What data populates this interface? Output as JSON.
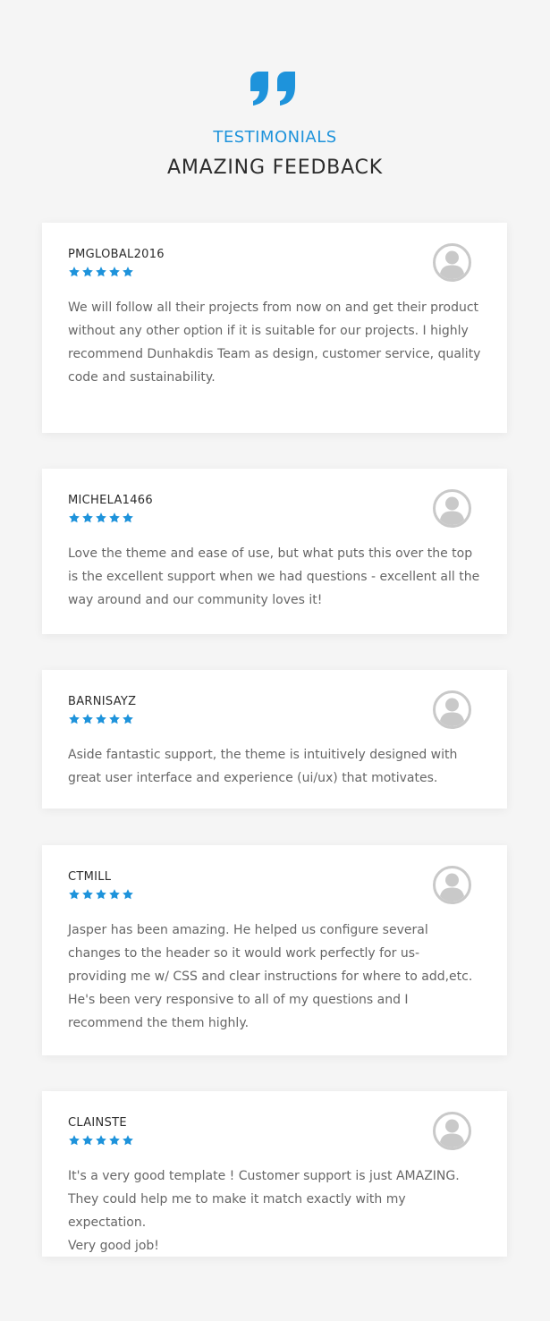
{
  "header": {
    "icon": "quote-icon",
    "label": "TESTIMONIALS",
    "title": "AMAZING FEEDBACK"
  },
  "colors": {
    "accent": "#1e93db",
    "heading": "#2b2b2b",
    "body_text": "#666666",
    "background": "#f5f5f5",
    "card": "#ffffff",
    "avatar": "#c9c9c9"
  },
  "testimonials": [
    {
      "name": "PMGLOBAL2016",
      "rating": 5,
      "avatar_icon": "user-avatar-icon",
      "text": "We will follow all their projects from now on and get their product without any other option if it is suitable for our projects. I highly recommend Dunhakdis Team as design, customer service, quality code and sustainability."
    },
    {
      "name": "MICHELA1466",
      "rating": 5,
      "avatar_icon": "user-avatar-icon",
      "text": "Love the theme and ease of use, but what puts this over the top is the excellent support when we had questions - excellent all the way around and our community loves it!"
    },
    {
      "name": "BARNISAYZ",
      "rating": 5,
      "avatar_icon": "user-avatar-icon",
      "text": "Aside fantastic support, the theme is intuitively designed with great user interface and experience (ui/ux) that motivates."
    },
    {
      "name": "CTMILL",
      "rating": 5,
      "avatar_icon": "user-avatar-icon",
      "text": "Jasper has been amazing. He helped us configure several changes to the header so it would work perfectly for us- providing me w/ CSS and clear instructions for where to add,etc. He's been very responsive to all of my questions and I recommend the them highly."
    },
    {
      "name": "CLAINSTE",
      "rating": 5,
      "avatar_icon": "user-avatar-icon",
      "text": "It's a very good template ! Customer support is just AMAZING. They could help me to make it match exactly with my expectation.\nVery good job!"
    }
  ]
}
